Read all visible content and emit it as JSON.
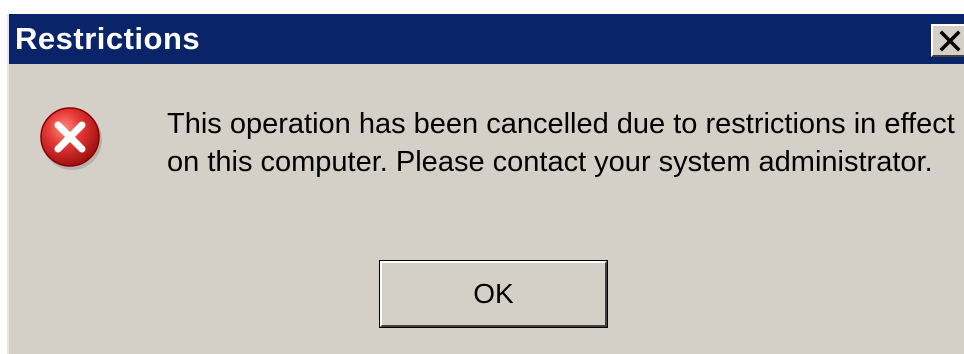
{
  "window": {
    "title": "Restrictions",
    "close_icon": "close-icon"
  },
  "dialog": {
    "icon": "error-icon",
    "message": "This operation has been cancelled due to restrictions in effect on this computer. Please contact your system administrator.",
    "ok_label": "OK"
  },
  "colors": {
    "titlebar": "#0a246a",
    "dialog_background": "#d4d0c8",
    "error_red": "#d42020"
  }
}
